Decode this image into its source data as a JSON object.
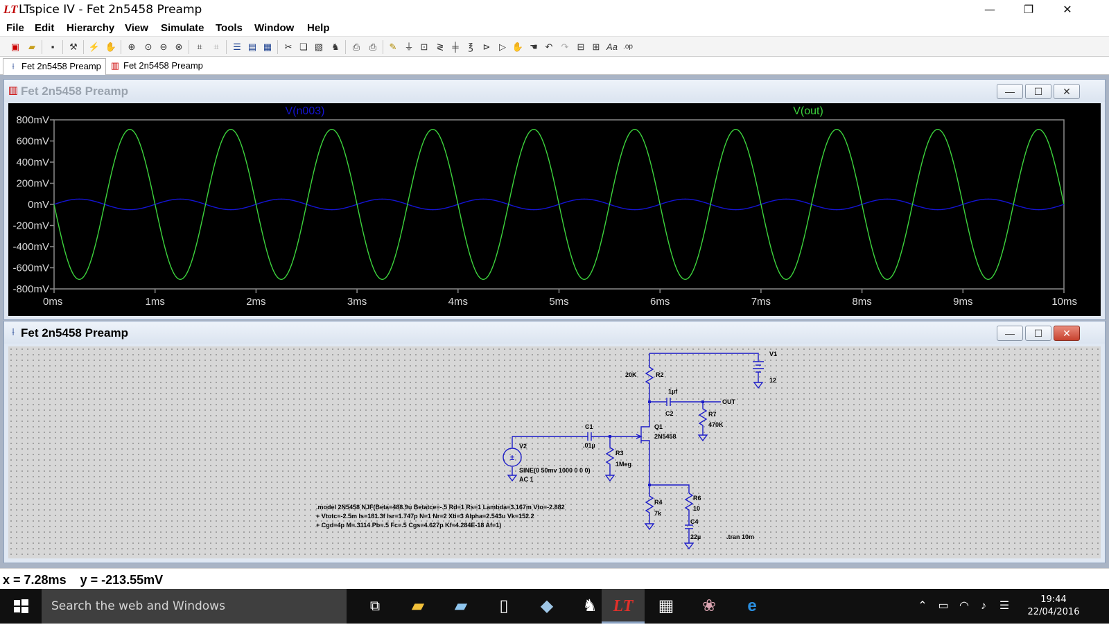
{
  "window": {
    "title": "LTspice IV - Fet 2n5458 Preamp",
    "logo": "LT",
    "min": "—",
    "restore": "❐",
    "close": "✕"
  },
  "menu": [
    "File",
    "Edit",
    "Hierarchy",
    "View",
    "Simulate",
    "Tools",
    "Window",
    "Help"
  ],
  "tabs": [
    {
      "label": "Fet 2n5458 Preamp",
      "icon": "schematic-icon",
      "active": true
    },
    {
      "label": "Fet 2n5458 Preamp",
      "icon": "waveform-icon",
      "active": false
    }
  ],
  "plot_window": {
    "title": "Fet 2n5458 Preamp",
    "btn_min": "—",
    "btn_max": "☐",
    "btn_close": "✕"
  },
  "chart_data": {
    "type": "line",
    "title": "",
    "xlabel": "",
    "ylabel": "",
    "xlim": [
      0,
      10
    ],
    "ylim": [
      -800,
      800
    ],
    "x_ticks": [
      "0ms",
      "1ms",
      "2ms",
      "3ms",
      "4ms",
      "5ms",
      "6ms",
      "7ms",
      "8ms",
      "9ms",
      "10ms"
    ],
    "y_ticks": [
      "800mV",
      "600mV",
      "400mV",
      "200mV",
      "0mV",
      "-200mV",
      "-400mV",
      "-600mV",
      "-800mV"
    ],
    "background": "#000000",
    "grid": false,
    "series": [
      {
        "name": "V(n003)",
        "color": "#1414d2",
        "amplitude_mV": 50,
        "frequency_kHz": 1,
        "phase": "sine",
        "samples": [
          0,
          50,
          0,
          -50,
          0
        ]
      },
      {
        "name": "V(out)",
        "color": "#3cd23c",
        "amplitude_mV": 710,
        "frequency_kHz": 1,
        "phase": "inverted",
        "samples": [
          0,
          -710,
          0,
          710,
          0
        ]
      }
    ]
  },
  "schematic_window": {
    "title": "Fet 2n5458 Preamp",
    "btn_min": "—",
    "btn_max": "☐",
    "btn_close": "✕"
  },
  "schematic": {
    "labels": {
      "v1": "V1",
      "v1_val": "12",
      "r2": "R2",
      "r2_val": "20K",
      "c2_val": "1µf",
      "c2": "C2",
      "out": "OUT",
      "r7": "R7",
      "r7_val": "470K",
      "q1": "Q1",
      "q1_val": "2N5458",
      "c1": "C1",
      "c1_val": ".01µ",
      "v2": "V2",
      "r3": "R3",
      "r3_val": "1Meg",
      "sine": "SINE(0 50mv 1000 0 0 0)",
      "ac": "AC 1",
      "r4": "R4",
      "r4_val": "7k",
      "r6": "R6",
      "r6_val": "10",
      "c4": "C4",
      "c4_val": "22µ",
      "tran": ".tran 10m"
    },
    "model_lines": [
      ".model 2N5458 NJF(Beta=488.9u Betatce=-.5 Rd=1 Rs=1 Lambda=3.167m Vto=-2.882",
      "+ Vtotc=-2.5m Is=181.3f Isr=1.747p N=1 Nr=2 Xti=3 Alpha=2.543u Vk=152.2",
      "+ Cgd=4p M=.3114 Pb=.5 Fc=.5 Cgs=4.627p Kf=4.284E-18 Af=1)"
    ]
  },
  "status": {
    "x": "x = 7.28ms",
    "y": "y = -213.55mV"
  },
  "taskbar": {
    "search_placeholder": "Search the web and Windows",
    "time": "19:44",
    "date": "22/04/2016"
  }
}
